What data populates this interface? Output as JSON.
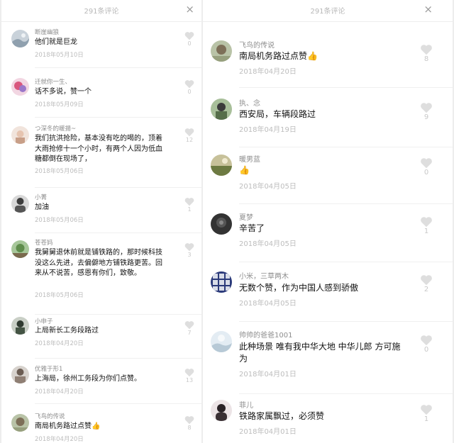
{
  "left_panel": {
    "title": "291条评论",
    "close_label": "×",
    "comments": [
      {
        "user": "断崖幽狼",
        "text": "他们就是巨龙",
        "date": "2018年05月10日",
        "likes": "0"
      },
      {
        "user": "迁就你一生、",
        "text": "话不多说，赞一个",
        "date": "2018年05月09日",
        "likes": "0"
      },
      {
        "user": "つ深冬的暖揚~",
        "text": "我们抗洪抢险，基本没有吃的喝的，顶着大雨抢修十一个小时，有两个人因为低血糖都倒在现场了，",
        "date": "2018年05月06日",
        "likes": "12"
      },
      {
        "user": "小菁",
        "text": "加油",
        "date": "2018年05月06日",
        "likes": "1"
      },
      {
        "user": "苍苍妈",
        "text": "我舅舅退休前就是铺铁路的，那时候科技没这么先进，去偏僻地方铺铁路更苦。回来从不说苦，感恩有你们，致敬。",
        "date": "2018年05月06日",
        "likes": "3"
      },
      {
        "user": "小申子",
        "text": "上局新长工务段路过",
        "date": "2018年04月20日",
        "likes": "7"
      },
      {
        "user": "优雅于形1",
        "text": "上海局，徐州工务段为你们点赞。",
        "date": "2018年04月20日",
        "likes": "13"
      },
      {
        "user": "飞鸟的传说",
        "text": "南局机务路过点赞",
        "thumb": "👍",
        "date": "2018年04月20日",
        "likes": "8"
      }
    ]
  },
  "right_panel": {
    "title": "291条评论",
    "close_label": "×",
    "comments": [
      {
        "user": "飞鸟的传说",
        "text": "南局机务路过点赞",
        "thumb": "👍",
        "date": "2018年04月20日",
        "likes": "8"
      },
      {
        "user": "执、念",
        "text": "西安局，车辆段路过",
        "date": "2018年04月19日",
        "likes": "9"
      },
      {
        "user": "暖男蓝",
        "text": "",
        "thumb": "👍",
        "date": "2018年04月05日",
        "likes": "0"
      },
      {
        "user": "夏梦",
        "text": "辛苦了",
        "date": "2018年04月05日",
        "likes": "1"
      },
      {
        "user": "小米，三草两木",
        "text": "无数个赞，作为中国人感到骄傲",
        "date": "2018年04月05日",
        "likes": "2"
      },
      {
        "user": "帅帅的爸爸1001",
        "text": "此种场景 唯有我中华大地 中华儿郎 方可施为",
        "date": "2018年04月01日",
        "likes": "0"
      },
      {
        "user": "菲儿",
        "text": "铁路家属飘过，必须赞",
        "date": "2018年04月01日",
        "likes": "1"
      }
    ]
  },
  "colors": {
    "background": "#ffffff",
    "username": "#8e8e8e",
    "date": "#bdbdbd",
    "like": "#c8c8c8",
    "thumb": "#f3b428"
  },
  "icons": {
    "close": "close-icon",
    "like": "heart-icon",
    "thumb": "thumbs-up-icon"
  }
}
